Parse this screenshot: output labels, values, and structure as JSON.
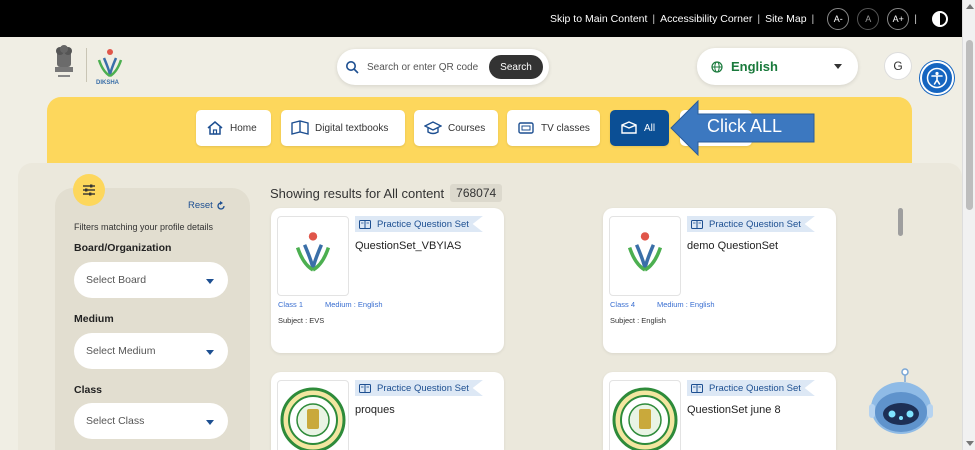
{
  "topbar": {
    "skip_link": "Skip to Main Content",
    "accessibility_link": "Accessibility Corner",
    "sitemap_link": "Site Map",
    "font_decrease": "A-",
    "font_normal": "A",
    "font_increase": "A+"
  },
  "header": {
    "diksha_text": "DIKSHA",
    "search_placeholder": "Search or enter QR code",
    "search_button": "Search",
    "language": "English",
    "avatar_initial": "G"
  },
  "nav": {
    "items": [
      {
        "label": "Home"
      },
      {
        "label": "Digital textbooks"
      },
      {
        "label": "Courses"
      },
      {
        "label": "TV classes"
      },
      {
        "label": "All"
      }
    ],
    "callout": "Click ALL"
  },
  "filters": {
    "reset": "Reset",
    "note": "Filters matching your profile details",
    "board_label": "Board/Organization",
    "board_placeholder": "Select Board",
    "medium_label": "Medium",
    "medium_placeholder": "Select Medium",
    "class_label": "Class",
    "class_placeholder": "Select Class"
  },
  "results": {
    "title": "Showing results for All content",
    "count": "768074",
    "cards": [
      {
        "tag": "Practice Question Set",
        "title": "QuestionSet_VBYIAS",
        "class": "Class 1",
        "medium": "Medium : English",
        "subject": "Subject : EVS"
      },
      {
        "tag": "Practice Question Set",
        "title": "demo QuestionSet",
        "class": "Class 4",
        "medium": "Medium : English",
        "subject": "Subject : English"
      },
      {
        "tag": "Practice Question Set",
        "title": "proques"
      },
      {
        "tag": "Practice Question Set",
        "title": "QuestionSet june 8"
      }
    ]
  },
  "colors": {
    "nav_band": "#fdd75c",
    "active_nav": "#0b4f95",
    "language_text": "#1a7a3c",
    "callout_arrow": "#3c78c0"
  }
}
